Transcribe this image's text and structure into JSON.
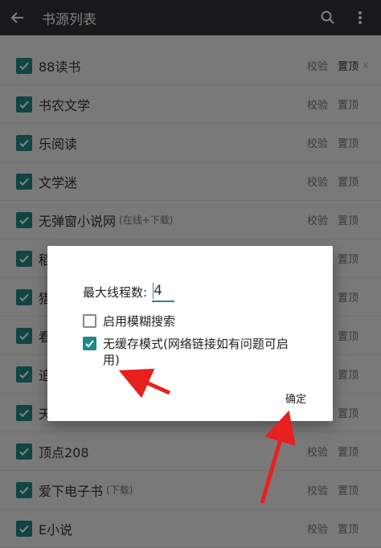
{
  "appbar": {
    "title": "书源列表",
    "icons": [
      "back-arrow-icon",
      "search-icon",
      "more-vert-icon"
    ]
  },
  "actions": {
    "verify": "校验",
    "pin": "置顶"
  },
  "list": [
    {
      "name": "88读书",
      "sub": "",
      "pin_strong": true,
      "close": true
    },
    {
      "name": "书农文学",
      "sub": ""
    },
    {
      "name": "乐阅读",
      "sub": ""
    },
    {
      "name": "文学迷",
      "sub": ""
    },
    {
      "name": "无弹窗小说网",
      "sub": "(在线+下载)"
    },
    {
      "name": "稻",
      "sub": ""
    },
    {
      "name": "猎",
      "sub": ""
    },
    {
      "name": "看",
      "sub": ""
    },
    {
      "name": "追",
      "sub": ""
    },
    {
      "name": "天",
      "sub": ""
    },
    {
      "name": "顶点208",
      "sub": ""
    },
    {
      "name": "爱下电子书",
      "sub": "(下载)"
    },
    {
      "name": "E小说",
      "sub": ""
    }
  ],
  "dialog": {
    "thread_label": "最大线程数:",
    "thread_value": "4",
    "options": [
      {
        "label": "启用模糊搜索",
        "checked": false
      },
      {
        "label": "无缓存模式(网络链接如有问题可启用)",
        "checked": true
      }
    ],
    "confirm": "确定"
  },
  "colors": {
    "accent": "#1f8a84",
    "appbar": "#2f3436",
    "annotation": "#e8201e"
  }
}
